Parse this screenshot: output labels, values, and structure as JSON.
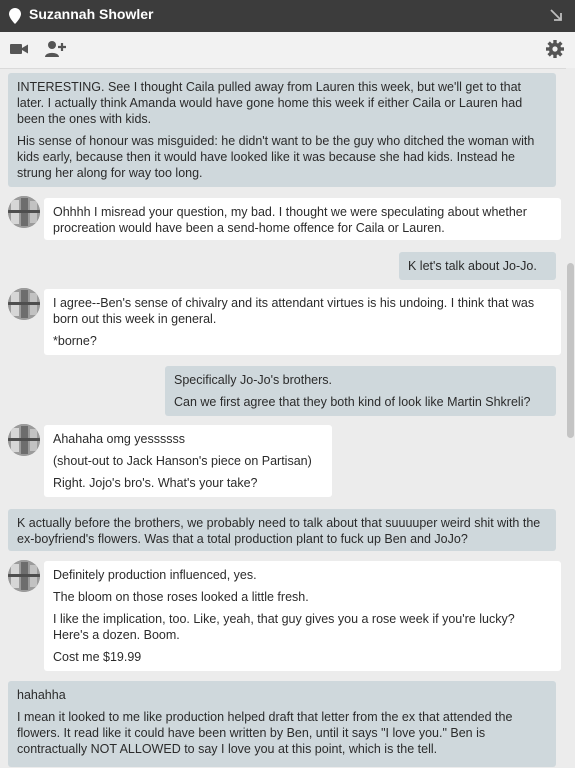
{
  "window": {
    "title": "Suzannah Showler"
  },
  "icons": {
    "pin": "location-pin-icon",
    "popout": "popout-arrow-icon",
    "video": "video-camera-icon",
    "add_person": "add-person-icon",
    "settings": "gear-icon"
  },
  "colors": {
    "titlebar": "#3c3c3c",
    "outgoing_bubble": "#cfd8dc",
    "incoming_bubble": "#ffffff",
    "background": "#ececec"
  },
  "messages": [
    {
      "side": "out",
      "paragraphs": [
        "INTERESTING. See I thought Caila pulled away from Lauren this week, but we'll get to that later. I actually think Amanda would have gone home this week if either Caila or Lauren had been the ones with kids.",
        "His sense of honour was misguided: he didn't want to be the guy who ditched the woman with kids early, because then it would have looked like it was because she had kids. Instead he strung her along for way too long."
      ]
    },
    {
      "side": "in",
      "paragraphs": [
        "Ohhhh I misread your question, my bad. I thought we were speculating about whether procreation would have been a send-home offence for Caila or Lauren."
      ]
    },
    {
      "side": "out",
      "paragraphs": [
        "K let's talk about Jo-Jo."
      ]
    },
    {
      "side": "in",
      "paragraphs": [
        "I agree--Ben's sense of chivalry and its attendant virtues is his undoing. I think that was born out this week in general.",
        "*borne?"
      ]
    },
    {
      "side": "out",
      "paragraphs": [
        "Specifically Jo-Jo's brothers.",
        "Can we first agree that they both kind of look like Martin Shkreli?"
      ]
    },
    {
      "side": "in",
      "paragraphs": [
        "Ahahaha omg yessssss",
        "(shout-out to Jack Hanson's piece on Partisan)",
        "Right. Jojo's bro's. What's your take?"
      ]
    },
    {
      "side": "out",
      "paragraphs": [
        "K actually before the brothers, we probably need to talk about that suuuuper weird shit with the ex-boyfriend's flowers. Was that a total production plant to fuck up Ben and JoJo?"
      ]
    },
    {
      "side": "in",
      "paragraphs": [
        "Definitely production influenced, yes.",
        "The bloom on those roses looked a little fresh.",
        "I like the implication, too. Like, yeah, that guy gives you a rose week if you're lucky? Here's a dozen. Boom.",
        "Cost me $19.99"
      ]
    },
    {
      "side": "out",
      "paragraphs": [
        "hahahha",
        "I mean it looked to me like production helped draft that letter from the ex that attended the flowers. It read like it could have been written by Ben, until it says \"I love you.\" Ben is contractually NOT ALLOWED to say I love you at this point, which is the tell."
      ]
    }
  ]
}
